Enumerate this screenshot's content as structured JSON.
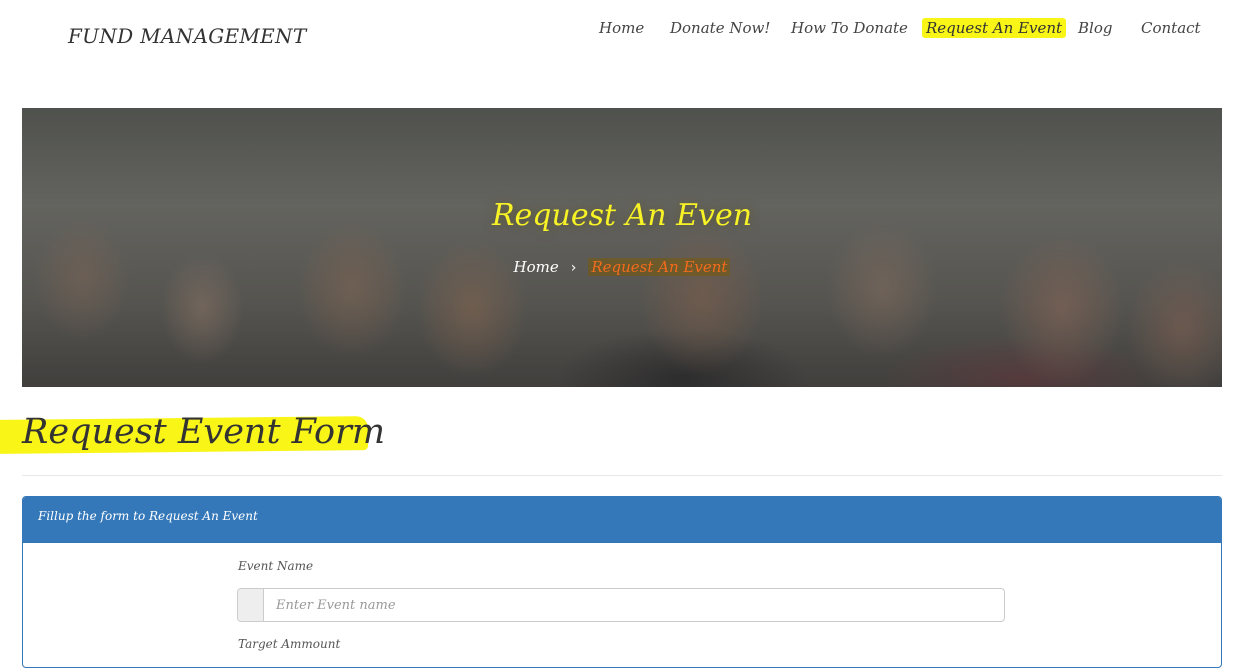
{
  "header": {
    "brand": "FUND MANAGEMENT",
    "nav": [
      {
        "label": "Home"
      },
      {
        "label": "Donate Now!"
      },
      {
        "label": "How To Donate"
      },
      {
        "label": "Request An Event",
        "active": true
      },
      {
        "label": "Blog"
      },
      {
        "label": "Contact"
      }
    ]
  },
  "hero": {
    "title": "Request An Even",
    "breadcrumb": {
      "home": "Home",
      "separator": "›",
      "current": "Request An Event"
    }
  },
  "main": {
    "heading": "Request Event Form",
    "panel": {
      "title": "Fillup the form to Request An Event",
      "fields": [
        {
          "label": "Event Name",
          "placeholder": "Enter Event name",
          "value": ""
        },
        {
          "label": "Target Ammount"
        }
      ]
    }
  },
  "colors": {
    "highlight": "#f8f517",
    "panel_blue": "#3478b9",
    "breadcrumb_current": "#f36b1c"
  }
}
